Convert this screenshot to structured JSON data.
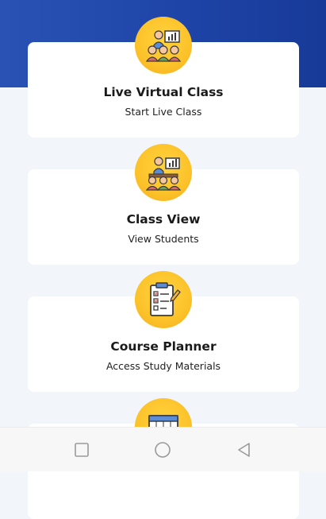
{
  "cards": [
    {
      "title": "Live Virtual Class",
      "subtitle": "Start Live Class",
      "icon": "virtual-class-icon"
    },
    {
      "title": "Class View",
      "subtitle": "View Students",
      "icon": "classroom-icon"
    },
    {
      "title": "Course Planner",
      "subtitle": "Access Study Materials",
      "icon": "checklist-clipboard-icon"
    },
    {
      "title": "",
      "subtitle": "",
      "icon": "timetable-icon"
    }
  ],
  "navbar": {
    "buttons": [
      "square-recents-icon",
      "circle-home-icon",
      "triangle-back-icon"
    ]
  },
  "colors": {
    "header": "#1d43a6",
    "icon_bg": "#fcc22a",
    "card_bg": "#ffffff",
    "page_bg": "#f2f5fa"
  }
}
